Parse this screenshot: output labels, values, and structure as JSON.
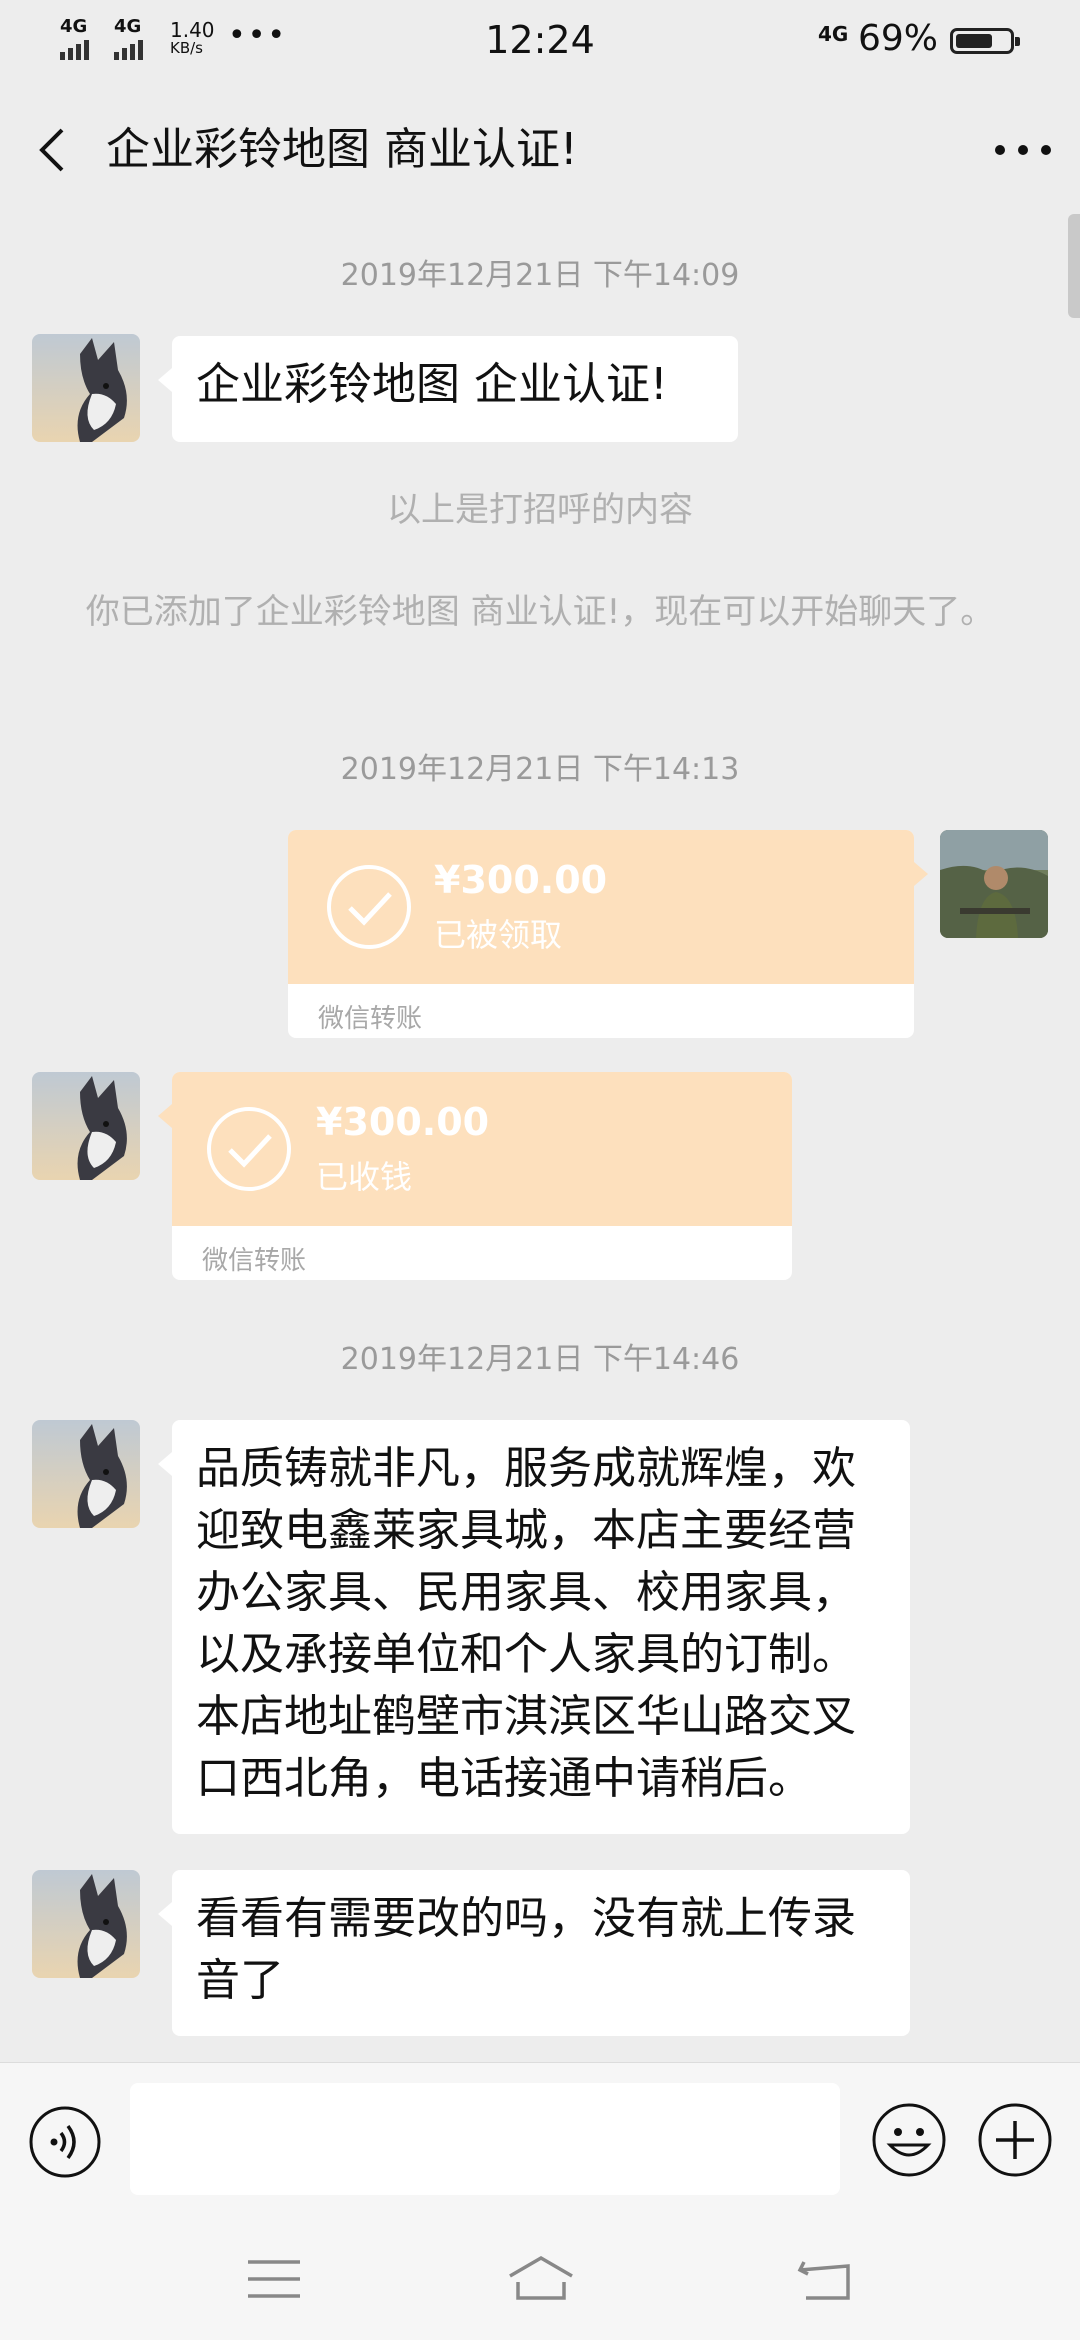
{
  "status_bar": {
    "network_1": "4G",
    "network_2": "4G",
    "speed_value": "1.40",
    "speed_unit": "KB/s",
    "more_dots": "•••",
    "time": "12:24",
    "network_right": "4G",
    "battery": "69%",
    "battery_level": 0.69
  },
  "header": {
    "title": "企业彩铃地图 商业认证!"
  },
  "chat": {
    "ts1": "2019年12月21日 下午14:09",
    "msg1": "企业彩铃地图 企业认证!",
    "sys1": "以上是打招呼的内容",
    "sys2": "你已添加了企业彩铃地图 商业认证!，现在可以开始聊天了。",
    "ts2": "2019年12月21日 下午14:13",
    "transfer1": {
      "amount": "¥300.00",
      "status": "已被领取",
      "label": "微信转账"
    },
    "transfer2": {
      "amount": "¥300.00",
      "status": "已收钱",
      "label": "微信转账"
    },
    "ts3": "2019年12月21日 下午14:46",
    "msg2": "品质铸就非凡，服务成就辉煌，欢迎致电鑫莱家具城，本店主要经营办公家具、民用家具、校用家具，以及承接单位和个人家具的订制。本店地址鹤壁市淇滨区华山路交叉口西北角，电话接通中请稍后。",
    "msg3": "看看有需要改的吗，没有就上传录音了"
  },
  "colors": {
    "background": "#ededed",
    "transfer_orange": "#fde0bd",
    "timestamp_gray": "#9a9a9a"
  }
}
